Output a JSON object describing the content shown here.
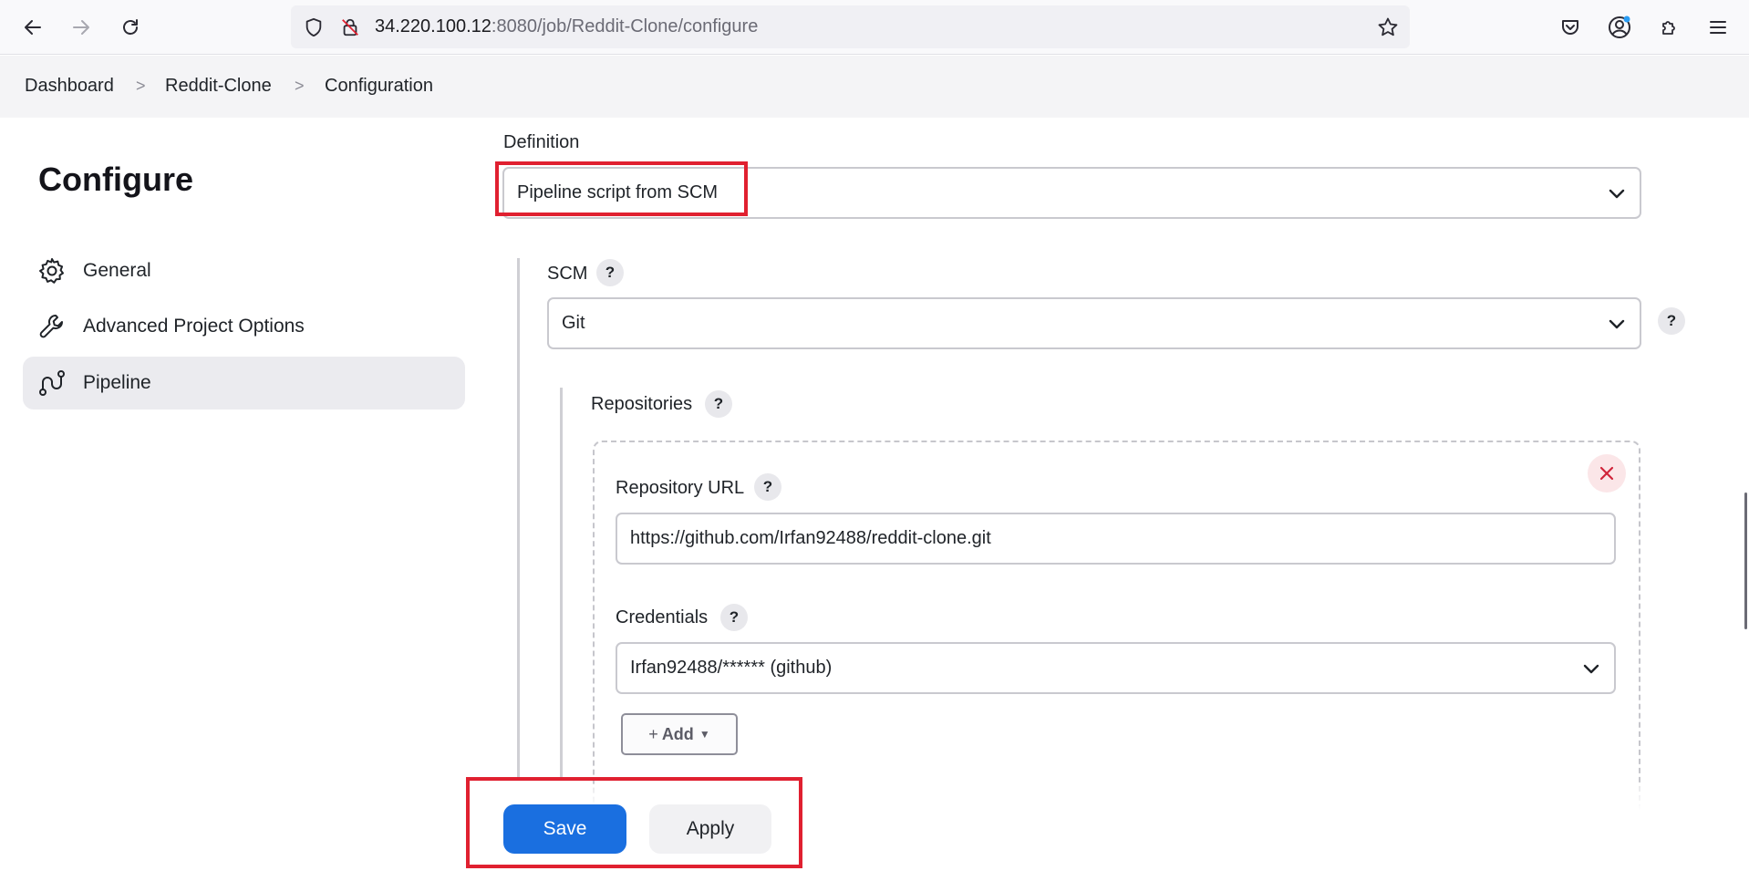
{
  "browser": {
    "url_host": "34.220.100.12",
    "url_path": ":8080/job/Reddit-Clone/configure"
  },
  "breadcrumb": {
    "items": [
      "Dashboard",
      "Reddit-Clone",
      "Configuration"
    ],
    "separator": ">"
  },
  "sidebar": {
    "title": "Configure",
    "items": [
      {
        "label": "General",
        "icon": "gear-icon"
      },
      {
        "label": "Advanced Project Options",
        "icon": "wrench-icon"
      },
      {
        "label": "Pipeline",
        "icon": "pipeline-icon",
        "active": true
      }
    ]
  },
  "form": {
    "definition_label": "Definition",
    "definition_value": "Pipeline script from SCM",
    "scm_label": "SCM",
    "scm_value": "Git",
    "repositories_label": "Repositories",
    "repository_url_label": "Repository URL",
    "repository_url_value": "https://github.com/Irfan92488/reddit-clone.git",
    "credentials_label": "Credentials",
    "credentials_value": "Irfan92488/****** (github)",
    "add_label": "Add",
    "help_glyph": "?"
  },
  "actions": {
    "save_label": "Save",
    "apply_label": "Apply"
  },
  "colors": {
    "accent": "#1a6fe0",
    "highlight": "#e02030",
    "delete": "#d0243a"
  }
}
